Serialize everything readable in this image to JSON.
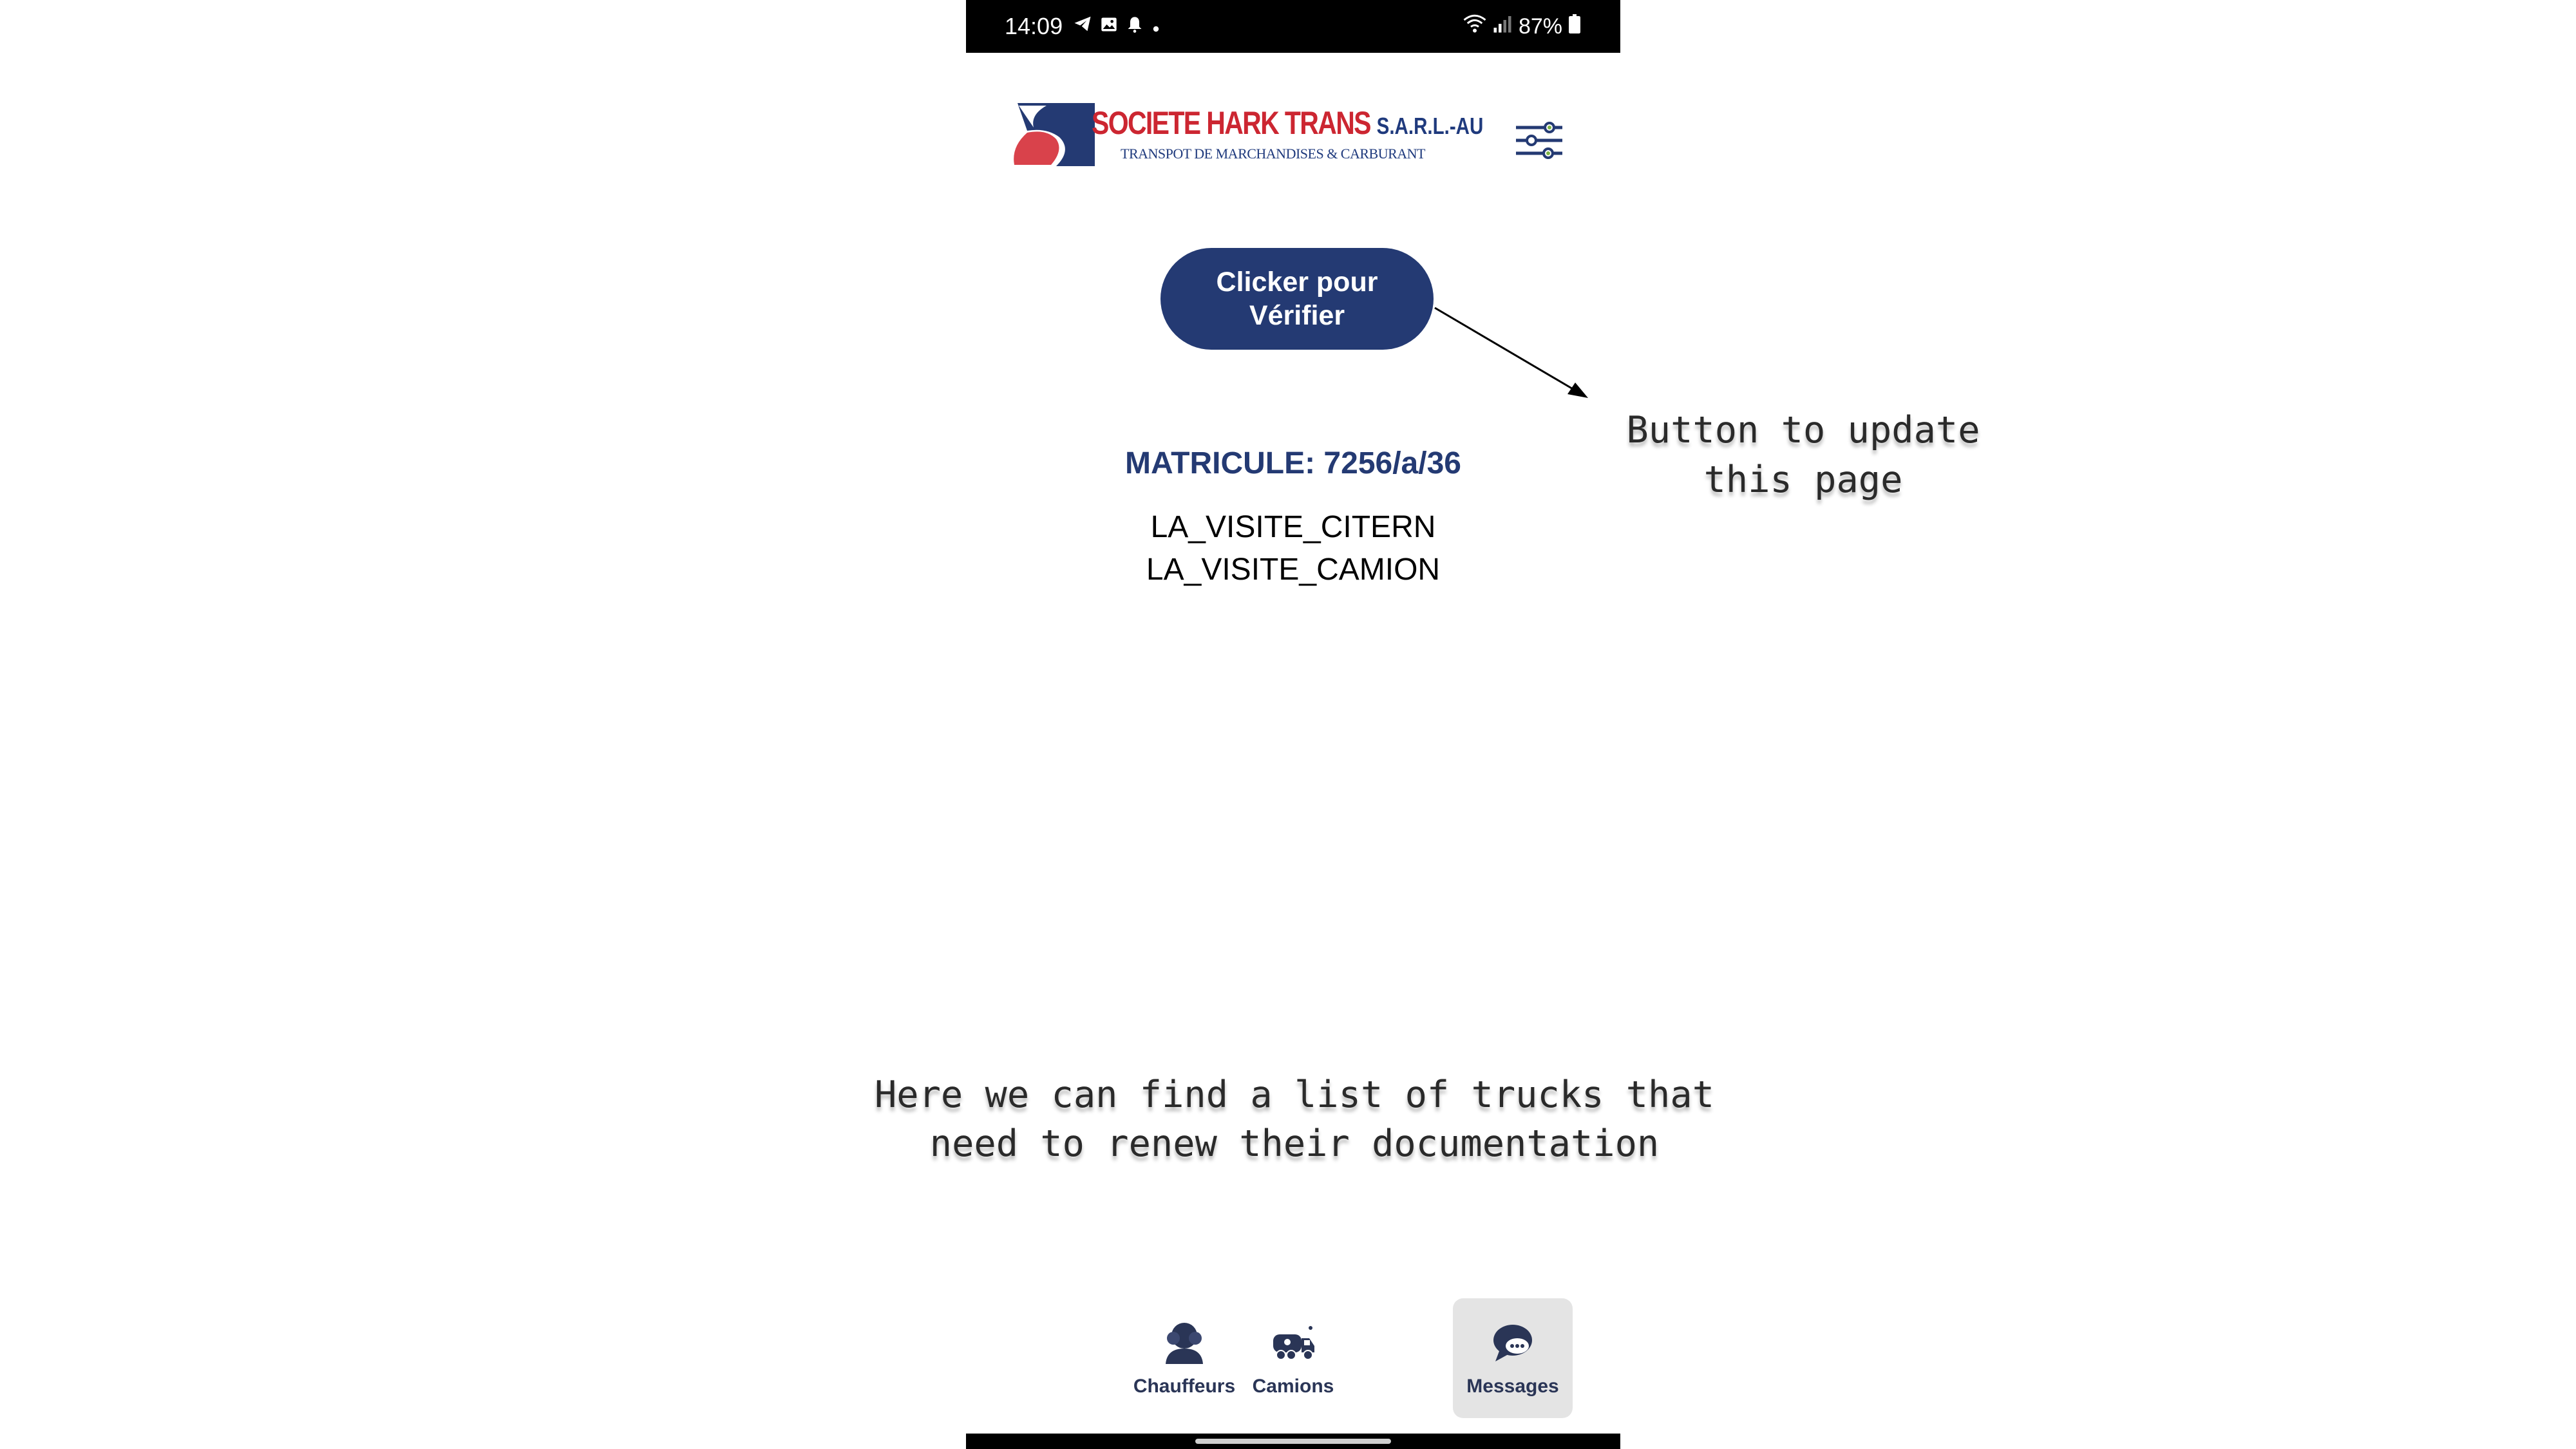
{
  "status_bar": {
    "time": "14:09",
    "battery": "87%",
    "icons": [
      "telegram-icon",
      "gallery-icon",
      "notification-bell-icon",
      "dot-icon",
      "wifi-icon",
      "signal-icon",
      "battery-icon"
    ]
  },
  "header": {
    "logo_title": "SOCIETE HARK TRANS",
    "logo_suffix": "S.A.R.L.-AU",
    "logo_subtitle": "TRANSPOT DE MARCHANDISES & CARBURANT",
    "settings_icon": "sliders-icon"
  },
  "verify_button": {
    "label": "Clicker pour Vérifier"
  },
  "content": {
    "matricule": "MATRICULE: 7256/a/36",
    "visits": [
      "LA_VISITE_CITERN",
      "LA_VISITE_CAMION"
    ]
  },
  "bottom_nav": {
    "active": "Messages",
    "items": [
      {
        "label": "Chauffeurs",
        "icon": "drivers-icon"
      },
      {
        "label": "Camions",
        "icon": "truck-icon"
      },
      {
        "label": "Messages",
        "icon": "chat-bubble-icon"
      }
    ]
  },
  "annotations": {
    "update_button": [
      "Button to update",
      "this page"
    ],
    "list_note": [
      "Here we can find a list of trucks that",
      "need to renew their documentation"
    ]
  },
  "colors": {
    "primary": "#243a73",
    "logo_red": "#cc2631",
    "status_bar": "#000000",
    "active_nav_bg": "#e4e4e4"
  }
}
